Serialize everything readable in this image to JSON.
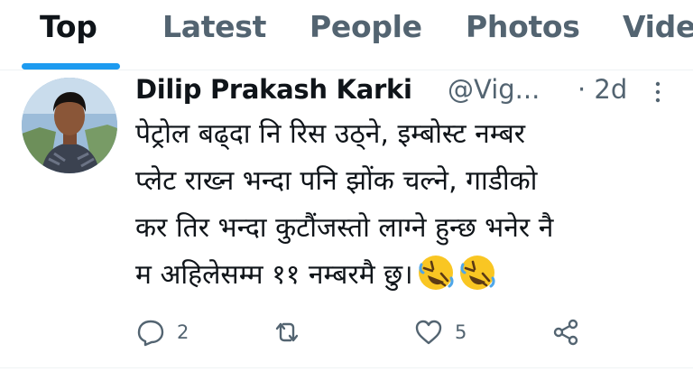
{
  "tabs": [
    {
      "label": "Top",
      "active": true
    },
    {
      "label": "Latest"
    },
    {
      "label": "People"
    },
    {
      "label": "Photos"
    },
    {
      "label": "Vide"
    }
  ],
  "tweet": {
    "author_name": "Dilip Prakash Karki",
    "author_handle": "@Vig...",
    "time": "· 2d",
    "text_lines": [
      "पेट्रोल बढ्दा नि रिस उठ्ने, इम्बोस्ट नम्बर",
      "प्लेट राख्न भन्दा पनि झोंक चल्ने, गाडीको",
      "कर तिर भन्दा कुटौंजस्तो लाग्ने हुन्छ भनेर नै",
      "म अहिलेसम्म ११ नम्बरमै छु।"
    ],
    "emojis": [
      "rolling-on-floor-laughing-emoji",
      "rolling-on-floor-laughing-emoji"
    ],
    "reply_count": "2",
    "retweet_count": "",
    "like_count": "5"
  },
  "colors": {
    "accent": "#1d9bf0",
    "text_primary": "#0f1419",
    "text_secondary": "#536471"
  }
}
